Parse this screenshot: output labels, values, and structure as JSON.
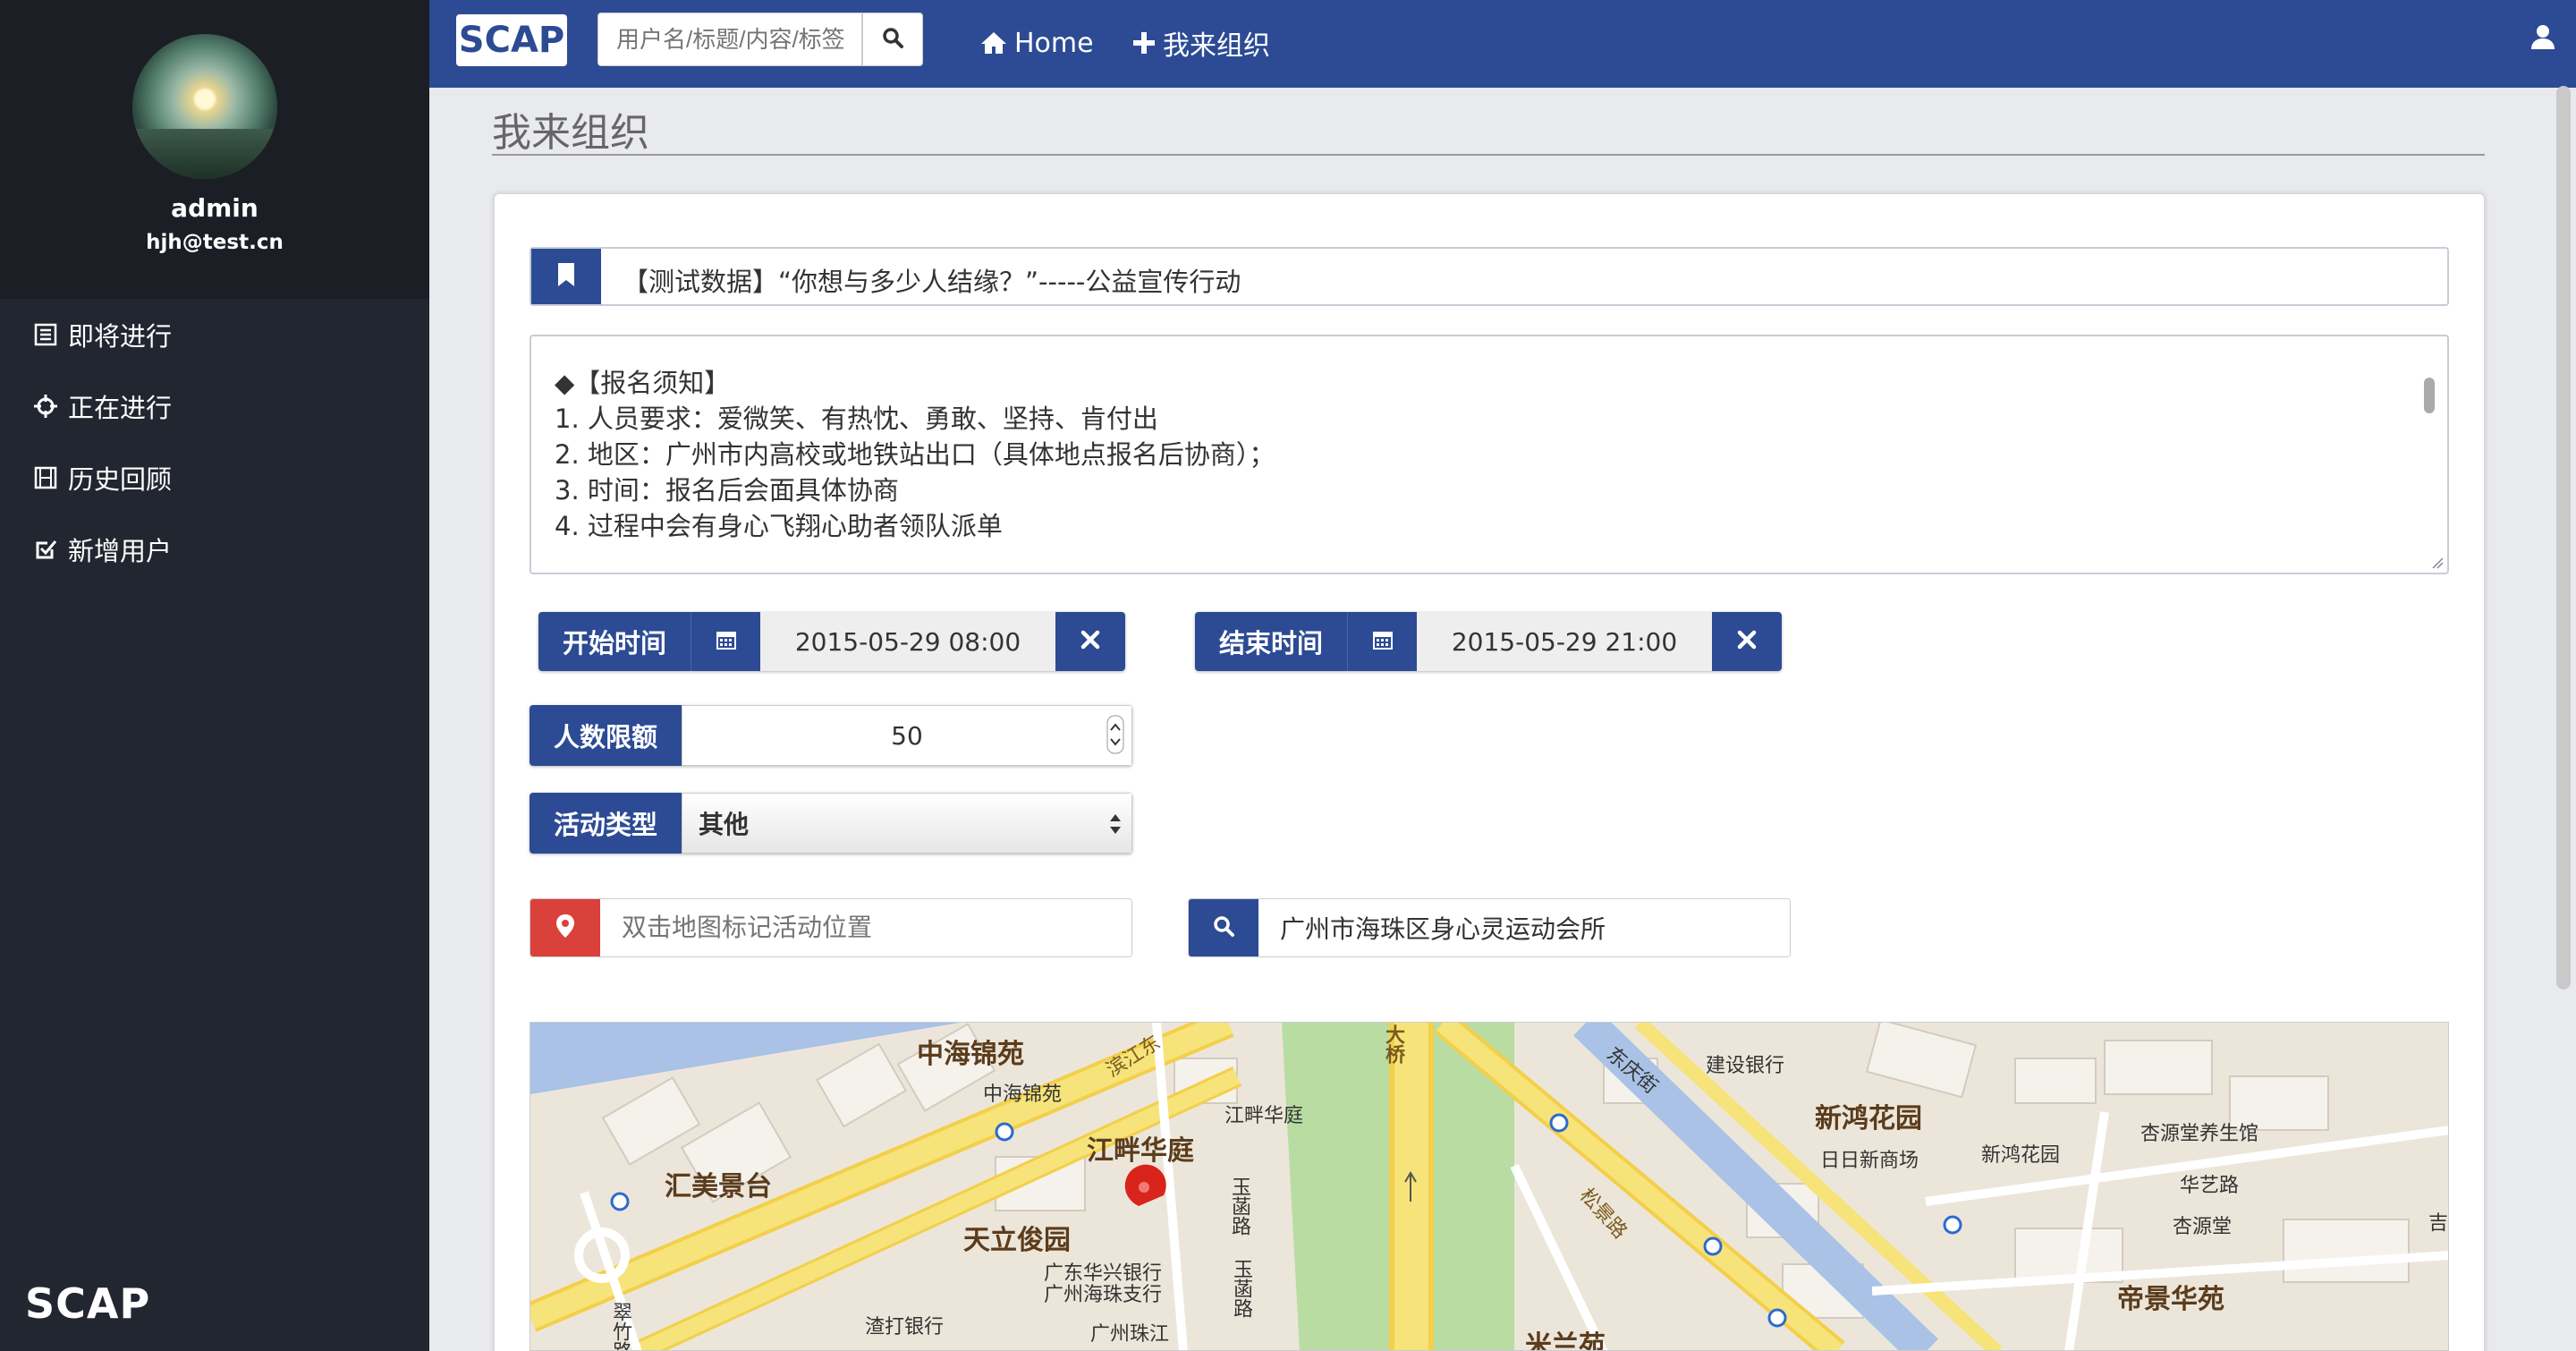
{
  "sidebar": {
    "username": "admin",
    "email": "hjh@test.cn",
    "items": [
      {
        "label": "即将进行",
        "icon": "list-icon"
      },
      {
        "label": "正在进行",
        "icon": "crosshair-icon"
      },
      {
        "label": "历史回顾",
        "icon": "film-icon"
      },
      {
        "label": "新增用户",
        "icon": "check-square-icon"
      }
    ],
    "brand": "SCAP"
  },
  "topbar": {
    "logo": "SCAP",
    "search_placeholder": "用户名/标题/内容/标签",
    "home_label": "Home",
    "organize_label": "我来组织"
  },
  "page": {
    "title": "我来组织"
  },
  "form": {
    "activity_title": "【测试数据】“你想与多少人结缘？”-----公益宣传行动",
    "description_lines": [
      "◆【报名须知】",
      "1. 人员要求：爱微笑、有热忱、勇敢、坚持、肯付出",
      "2. 地区：广州市内高校或地铁站出口（具体地点报名后协商）；",
      "3. 时间：报名后会面具体协商",
      "4. 过程中会有身心飞翔心助者领队派单"
    ],
    "start_label": "开始时间",
    "start_value": "2015-05-29 08:00",
    "end_label": "结束时间",
    "end_value": "2015-05-29 21:00",
    "quota_label": "人数限额",
    "quota_value": "50",
    "type_label": "活动类型",
    "type_value": "其他",
    "location_placeholder": "双击地图标记活动位置",
    "search_location_value": "广州市海珠区身心灵运动会所"
  },
  "map": {
    "labels_large": [
      "中海锦苑",
      "汇美景台",
      "江畔华庭",
      "天立俊园",
      "新鸿花园",
      "帝景华苑",
      "米兰苑"
    ],
    "labels_small": [
      "中海锦苑",
      "江畔华庭",
      "广东华兴银行",
      "广州海珠支行",
      "渣打银行",
      "广州珠江",
      "建设银行",
      "日日新商场",
      "新鸿花园",
      "杏源堂养生馆",
      "华艺路",
      "杏源堂",
      "吉",
      "大桥",
      "滨江东",
      "玉菡路",
      "玉菡路",
      "东庆街",
      "松景路",
      "翠竹路"
    ],
    "colors": {
      "road": "#f6e37a",
      "river": "#a9c2e6",
      "park": "#b9dca3",
      "land": "#ece6da"
    }
  }
}
